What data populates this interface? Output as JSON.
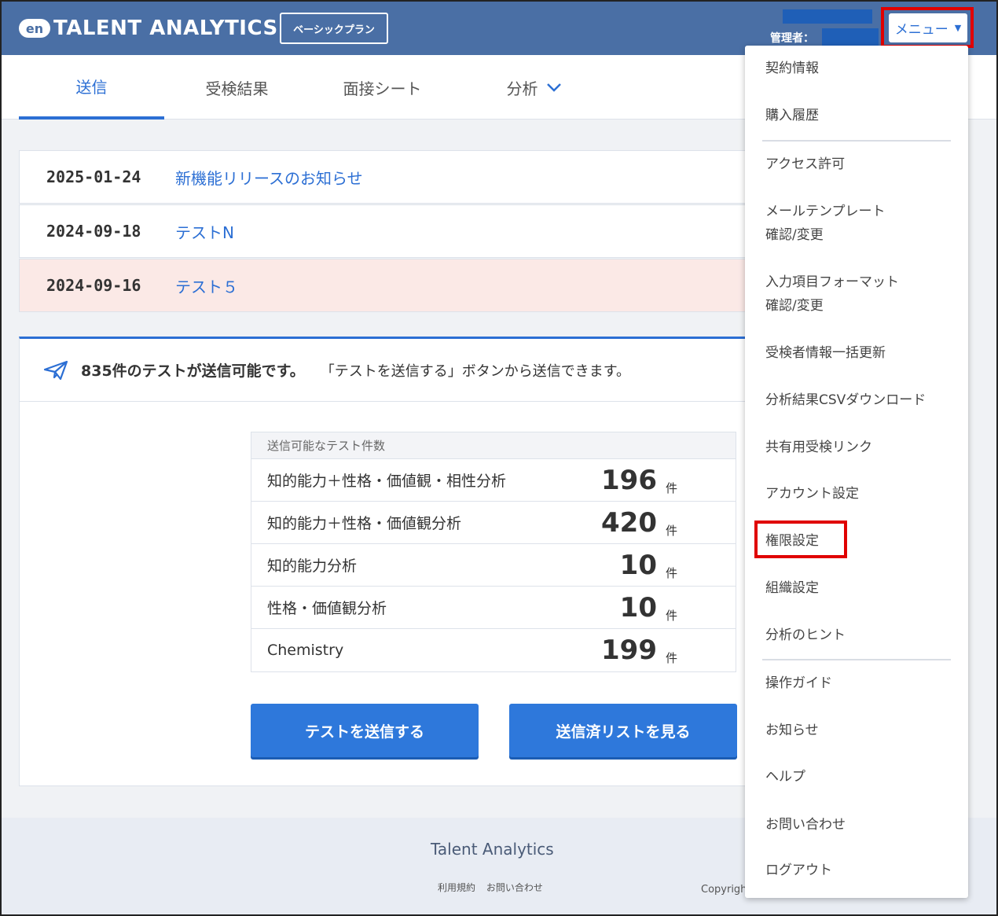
{
  "header": {
    "logo_mark": "en",
    "logo_text": "TALENT ANALYTICS",
    "plan_badge": "ベーシックプラン",
    "admin_label": "管理者：",
    "menu_label": "メニュー",
    "menu_caret": "▼"
  },
  "tabs": [
    {
      "label": "送信"
    },
    {
      "label": "受検結果"
    },
    {
      "label": "面接シート"
    },
    {
      "label": "分析"
    }
  ],
  "news": [
    {
      "date": "2025-01-24",
      "title": "新機能リリースのお知らせ"
    },
    {
      "date": "2024-09-18",
      "title": "テストN"
    },
    {
      "date": "2024-09-16",
      "title": "テスト５"
    }
  ],
  "card": {
    "message_bold": "835件のテストが送信可能です。",
    "message": "「テストを送信する」ボタンから送信できます。",
    "table_header": "送信可能なテスト件数",
    "rows": [
      {
        "label": "知的能力＋性格・価値観・相性分析",
        "count": "196",
        "unit": "件"
      },
      {
        "label": "知的能力＋性格・価値観分析",
        "count": "420",
        "unit": "件"
      },
      {
        "label": "知的能力分析",
        "count": "10",
        "unit": "件"
      },
      {
        "label": "性格・価値観分析",
        "count": "10",
        "unit": "件"
      },
      {
        "label": "Chemistry",
        "count": "199",
        "unit": "件"
      }
    ],
    "send_button": "テストを送信する",
    "sent_list_button": "送信済リストを見る"
  },
  "footer": {
    "brand": "Talent Analytics",
    "terms": "利用規約",
    "contact": "お問い合わせ",
    "copyright": "Copyrigh"
  },
  "dropdown": {
    "items": [
      "契約情報",
      "購入履歴",
      "アクセス許可",
      "メールテンプレート",
      "確認/変更",
      "入力項目フォーマット",
      "確認/変更",
      "受検者情報一括更新",
      "分析結果CSVダウンロード",
      "共有用受検リンク",
      "アカウント設定",
      "権限設定",
      "組織設定",
      "分析のヒント",
      "操作ガイド",
      "お知らせ",
      "ヘルプ",
      "お問い合わせ",
      "ログアウト"
    ]
  },
  "colors": {
    "header_bg": "#4a6fa5",
    "accent": "#2c6fd4",
    "highlight_row": "#fbe9e6",
    "annotation_red": "#e00000"
  }
}
